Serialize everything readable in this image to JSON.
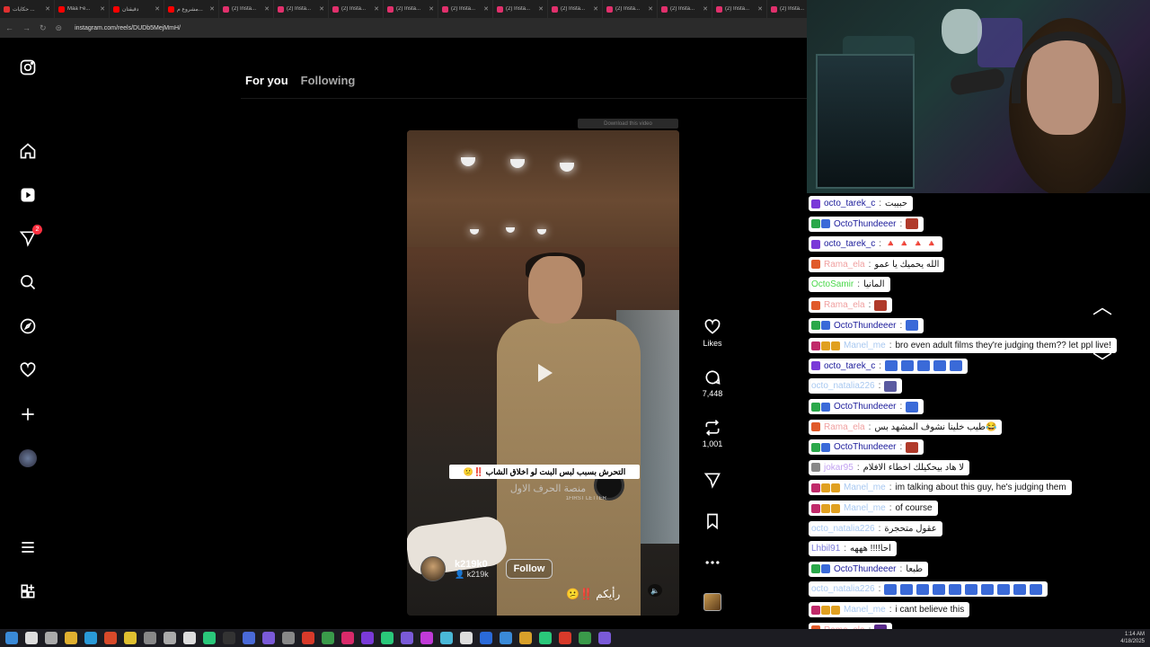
{
  "browser": {
    "tabs": [
      {
        "label": "حكايات ...",
        "color": "#e03030"
      },
      {
        "label": "Maa Fe...",
        "color": "#ff0000"
      },
      {
        "label": "دقيقتان",
        "color": "#ff0000"
      },
      {
        "label": "مشروع م...",
        "color": "#ff0000"
      },
      {
        "label": "(2) Insta...",
        "color": "#e1306c"
      },
      {
        "label": "(2) Insta...",
        "color": "#e1306c"
      },
      {
        "label": "(2) Insta...",
        "color": "#e1306c"
      },
      {
        "label": "(2) Insta...",
        "color": "#e1306c"
      },
      {
        "label": "(2) Insta...",
        "color": "#e1306c"
      },
      {
        "label": "(2) Insta...",
        "color": "#e1306c"
      },
      {
        "label": "(2) Insta...",
        "color": "#e1306c"
      },
      {
        "label": "(2) Insta...",
        "color": "#e1306c"
      },
      {
        "label": "(2) Insta...",
        "color": "#e1306c"
      },
      {
        "label": "(2) Insta...",
        "color": "#e1306c"
      },
      {
        "label": "(2) Insta...",
        "color": "#e1306c"
      }
    ],
    "url": "instagram.com/reels/DUDb5MejMmH/"
  },
  "instagram": {
    "notification_count": "2",
    "feed_tabs": {
      "active": "For you",
      "inactive": "Following"
    },
    "download_bar": "Download this video",
    "reel": {
      "caption": "التحرش بسبب لبس البنت لو اخلاق الشاب ‼️😕",
      "caption_sub": "منصة الحرف الاول",
      "watermark": "1FIRST LETTER",
      "username": "k219k0",
      "sub_handle": "k219k",
      "follow_label": "Follow",
      "music": "رأيكم ‼️😕"
    },
    "actions": {
      "likes_label": "Likes",
      "comments": "7,448",
      "reposts": "1,001"
    }
  },
  "chat": {
    "messages": [
      {
        "user": "octo_tarek_c",
        "user_color": "#1a1a9a",
        "text": "حبيبت",
        "badges": [
          "#7a3ad8"
        ],
        "emote": null
      },
      {
        "user": "OctoThundeeer",
        "user_color": "#1a1a9a",
        "text": "",
        "badges": [
          "#2aa84a",
          "#3a6ad8"
        ],
        "emote": "#b03a2a"
      },
      {
        "user": "octo_tarek_c",
        "user_color": "#1a1a9a",
        "text": "🔺 🔺 🔺 🔺",
        "badges": [
          "#7a3ad8"
        ],
        "emote": null
      },
      {
        "user": "Rama_ela",
        "user_color": "#f0a0a0",
        "text": "الله يحميك يا عمو",
        "badges": [
          "#e05a2a"
        ],
        "emote": null
      },
      {
        "user": "OctoSamir",
        "user_color": "#4ad84a",
        "text": "المانيا",
        "badges": [],
        "emote": null
      },
      {
        "user": "Rama_ela",
        "user_color": "#f0a0a0",
        "text": "",
        "badges": [
          "#e05a2a"
        ],
        "emote": "#b03a2a"
      },
      {
        "user": "OctoThundeeer",
        "user_color": "#1a1a9a",
        "text": "",
        "badges": [
          "#2aa84a",
          "#3a6ad8"
        ],
        "emote": "#3a6ad8"
      },
      {
        "user": "Manel_me",
        "user_color": "#a8c8f0",
        "text": "bro even adult films they're judging them?? let ppl live!",
        "badges": [
          "#c02a6a",
          "#e0a020",
          "#e0a020"
        ],
        "emote": null
      },
      {
        "user": "octo_tarek_c",
        "user_color": "#1a1a9a",
        "text": "",
        "badges": [
          "#7a3ad8"
        ],
        "emote": "#3a6ad8",
        "emote_count": 5
      },
      {
        "user": "octo_natalia226",
        "user_color": "#a8c8f0",
        "text": "",
        "badges": [],
        "emote": "#5a5aa0"
      },
      {
        "user": "OctoThundeeer",
        "user_color": "#1a1a9a",
        "text": "",
        "badges": [
          "#2aa84a",
          "#3a6ad8"
        ],
        "emote": "#3a6ad8"
      },
      {
        "user": "Rama_ela",
        "user_color": "#f0a0a0",
        "text": "طيب خلينا نشوف المشهد بس😂",
        "badges": [
          "#e05a2a"
        ],
        "emote": null
      },
      {
        "user": "OctoThundeeer",
        "user_color": "#1a1a9a",
        "text": "",
        "badges": [
          "#2aa84a",
          "#3a6ad8"
        ],
        "emote": "#b03a2a"
      },
      {
        "user": "jokar95",
        "user_color": "#c0a0f0",
        "text": "لا هاد بيحكيلك اخطاء الافلام",
        "badges": [
          "#888888"
        ],
        "emote": null
      },
      {
        "user": "Manel_me",
        "user_color": "#a8c8f0",
        "text": "im talking about this guy, he's judging them",
        "badges": [
          "#c02a6a",
          "#e0a020",
          "#e0a020"
        ],
        "emote": null
      },
      {
        "user": "Manel_me",
        "user_color": "#a8c8f0",
        "text": "of course",
        "badges": [
          "#c02a6a",
          "#e0a020",
          "#e0a020"
        ],
        "emote": null
      },
      {
        "user": "octo_natalia226",
        "user_color": "#a8c8f0",
        "text": "عقول متحجرة",
        "badges": [],
        "emote": null
      },
      {
        "user": "Lhbil91",
        "user_color": "#7a7ad8",
        "text": "احا!!!! هههه",
        "badges": [],
        "emote": null
      },
      {
        "user": "OctoThundeeer",
        "user_color": "#1a1a9a",
        "text": "طبعا",
        "badges": [
          "#2aa84a",
          "#3a6ad8"
        ],
        "emote": null
      },
      {
        "user": "octo_natalia226",
        "user_color": "#a8c8f0",
        "text": "",
        "badges": [],
        "emote": "#3a6ad8",
        "emote_count": 10
      },
      {
        "user": "Manel_me",
        "user_color": "#a8c8f0",
        "text": "i cant believe this",
        "badges": [
          "#c02a6a",
          "#e0a020",
          "#e0a020"
        ],
        "emote": null
      },
      {
        "user": "Rama_ela",
        "user_color": "#f0a0a0",
        "text": "",
        "badges": [
          "#e05a2a"
        ],
        "emote": "#5a2a8a"
      }
    ]
  },
  "system": {
    "time": "1:14 AM",
    "date": "4/18/2025"
  }
}
